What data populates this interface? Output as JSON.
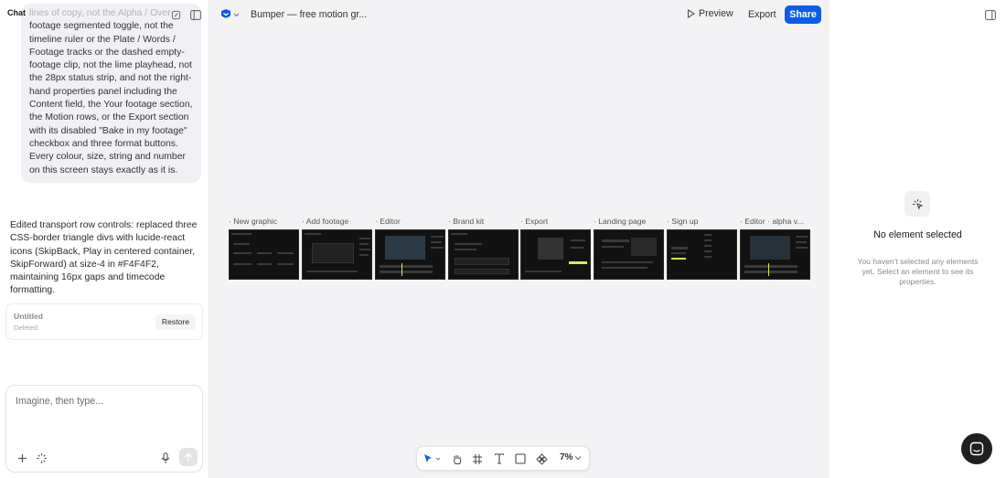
{
  "chat": {
    "title": "Chat",
    "user_message_faded": "lines of copy, not the Alpha / Over",
    "user_message": "footage segmented toggle, not the timeline ruler or the Plate / Words / Footage tracks or the dashed empty-footage clip, not the lime playhead, not the 28px status strip, and not the right-hand properties panel including the Content field, the Your footage section, the Motion rows, or the Export section with its disabled \"Bake in my footage\" checkbox and three format buttons. Every colour, size, string and number on this screen stays exactly as it is.",
    "assistant_message": "Edited transport row controls: replaced three CSS-border triangle divs with lucide-react icons (SkipBack, Play in centered container, SkipForward) at size-4 in #F4F4F2, maintaining 16px gaps and timecode formatting.",
    "version": {
      "name": "Untitled",
      "status": "Deleted",
      "restore_label": "Restore"
    },
    "composer": {
      "placeholder": "Imagine, then type..."
    }
  },
  "topbar": {
    "project_title": "Bumper — free motion gr...",
    "preview_label": "Preview",
    "export_label": "Export",
    "share_label": "Share"
  },
  "frames": [
    {
      "label": "· New graphic"
    },
    {
      "label": "· Add footage"
    },
    {
      "label": "· Editor"
    },
    {
      "label": "· Brand kit"
    },
    {
      "label": "· Export"
    },
    {
      "label": "· Landing page"
    },
    {
      "label": "· Sign up"
    },
    {
      "label": "· Editor · alpha v..."
    }
  ],
  "toolbar": {
    "zoom": "7%"
  },
  "properties": {
    "empty_title": "No element selected",
    "empty_description": "You haven't selected any elements yet. Select an element to see its properties."
  },
  "colors": {
    "accent": "#0b5de8",
    "canvas_bg": "#f3f3f5",
    "lime": "#c8f25a"
  }
}
